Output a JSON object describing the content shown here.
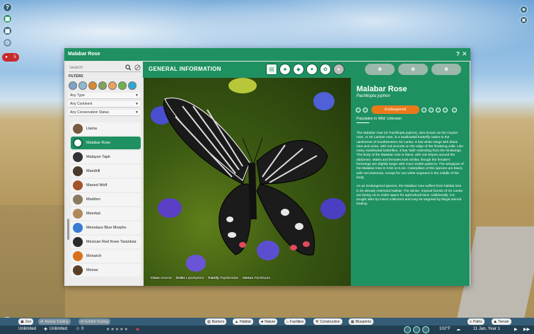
{
  "hud": {
    "help_glyph": "?",
    "alert_count": "5"
  },
  "window": {
    "title": "Malabar Rose",
    "help_glyph": "?",
    "close_glyph": "✕"
  },
  "search": {
    "placeholder": "Search"
  },
  "filters": {
    "label": "FILTERS",
    "dropdowns": [
      "Any Type",
      "Any Continent",
      "Any Conservation Status"
    ]
  },
  "species_list": [
    {
      "name": "Llama"
    },
    {
      "name": "Malabar Rose"
    },
    {
      "name": "Malayan Tapir"
    },
    {
      "name": "Mandrill"
    },
    {
      "name": "Maned Wolf"
    },
    {
      "name": "Markhor"
    },
    {
      "name": "Meerkat"
    },
    {
      "name": "Menelaus Blue Morpho"
    },
    {
      "name": "Mexican Red Knee Tarantula"
    },
    {
      "name": "Monarch"
    },
    {
      "name": "Moose"
    }
  ],
  "selected_species_index": 1,
  "section": {
    "title": "GENERAL INFORMATION"
  },
  "info": {
    "name": "Malabar Rose",
    "latin": "Pachliopta jophon",
    "status": "Endangered",
    "population": "Population In Wild: Unknown",
    "description_1": "The Malabar rose (or Pachliopta jophon), also known as the Ceylon rose, or Sri Lankan rose, is a swallowtail butterfly native to the rainforests of Southwestern Sri Lanka. It has white wings with black rims and veins, with red accents on the edge of the hindwing cells. Like many swallowtail butterflies, it has 'tails' extending from the hindwings. The body of the Malabar rose is black, with red stripes around the abdomen. Males and females look similar, though the female's forewings are slightly larger with more visible patterns. The wingspan of the Malabar rose is 3.5in to 5.1in. Caterpillars of this species are black, with red antennas, except for one white segment in the middle of the body.",
    "description_2": "As an Endangered species, the Malabar rose suffers from habitat loss in its already restricted habitat. The dense, tropical forests of Sri Lanka are being cut to make space for agricultural land. Additionally, it is sought after by insect collectors and may be targeted by illegal animal trading."
  },
  "taxonomy": {
    "class_label": "Class",
    "class_value": "Insecta",
    "order_label": "Order",
    "order_value": "Lepidoptera",
    "family_label": "Family",
    "family_value": "Papilionidae",
    "genus_label": "Genus",
    "genus_value": "Pachliopta"
  },
  "bottom_bar": {
    "zoo": "Zoo",
    "animal_trading": "Animal Trading",
    "exhibit_trading": "Exhibit Trading",
    "barriers": "Barriers",
    "habitat": "Habitat",
    "nature": "Nature",
    "facilities": "Facilities",
    "construction": "Construction",
    "blueprints": "Blueprints",
    "paths": "Paths",
    "terrain": "Terrain"
  },
  "status_bar": {
    "money": "Unlimited",
    "research": "Unlimited",
    "guests": "0",
    "temperature": "102°F",
    "date": "11 Jan, Year 1"
  },
  "colors": {
    "accent": "#1f9161",
    "status_endangered": "#e97a1c",
    "alert": "#c72a2a"
  }
}
